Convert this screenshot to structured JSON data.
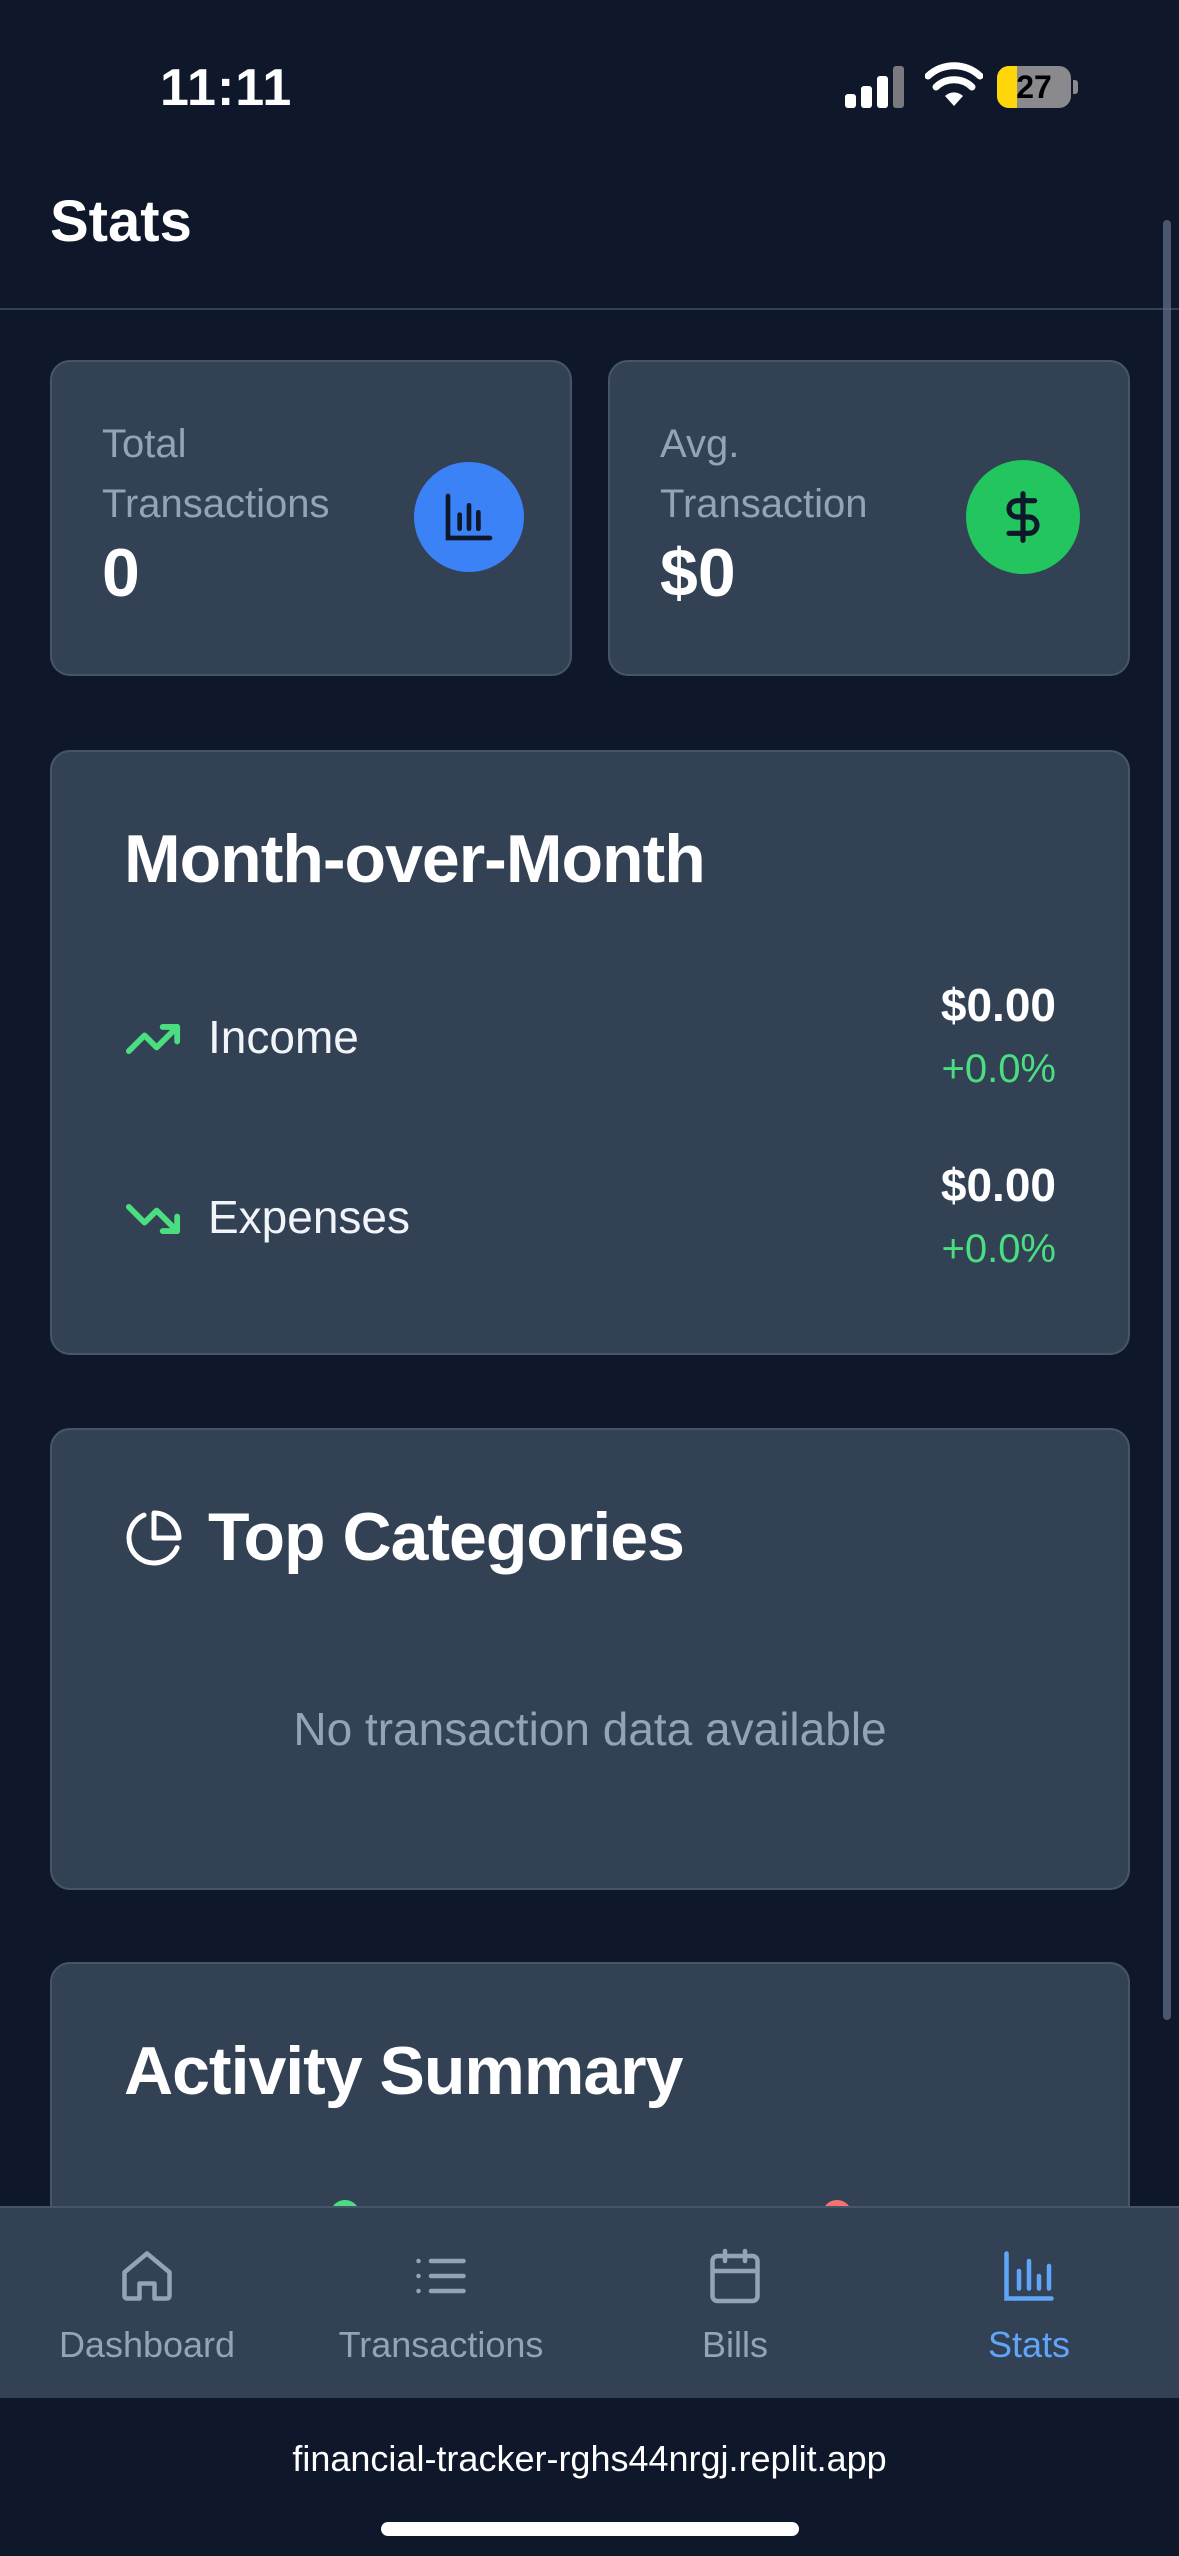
{
  "status_bar": {
    "time": "11:11",
    "battery": "27",
    "battery_level": 0.27
  },
  "header": {
    "title": "Stats"
  },
  "stats": {
    "total_transactions": {
      "label": "Total Transactions",
      "value": "0",
      "icon": "bar-chart-icon",
      "color": "#3b82f6"
    },
    "avg_transaction": {
      "label": "Avg. Transaction",
      "value": "$0",
      "icon": "dollar-icon",
      "color": "#22c55e"
    }
  },
  "month_over_month": {
    "title": "Month-over-Month",
    "income": {
      "label": "Income",
      "amount": "$0.00",
      "change": "+0.0%",
      "icon": "trending-up-icon"
    },
    "expenses": {
      "label": "Expenses",
      "amount": "$0.00",
      "change": "+0.0%",
      "icon": "trending-down-icon"
    }
  },
  "top_categories": {
    "title": "Top Categories",
    "icon": "pie-chart-icon",
    "empty_message": "No transaction data available"
  },
  "activity_summary": {
    "title": "Activity Summary"
  },
  "nav": {
    "items": [
      {
        "label": "Dashboard",
        "icon": "home-icon"
      },
      {
        "label": "Transactions",
        "icon": "list-icon"
      },
      {
        "label": "Bills",
        "icon": "calendar-icon"
      },
      {
        "label": "Stats",
        "icon": "bar-chart-icon",
        "active": true
      }
    ]
  },
  "browser": {
    "url": "financial-tracker-rghs44nrgj.replit.app"
  },
  "colors": {
    "background": "#0f172a",
    "card": "#334155",
    "accent": "#60a5fa",
    "positive": "#4ade80",
    "negative": "#f87171"
  }
}
